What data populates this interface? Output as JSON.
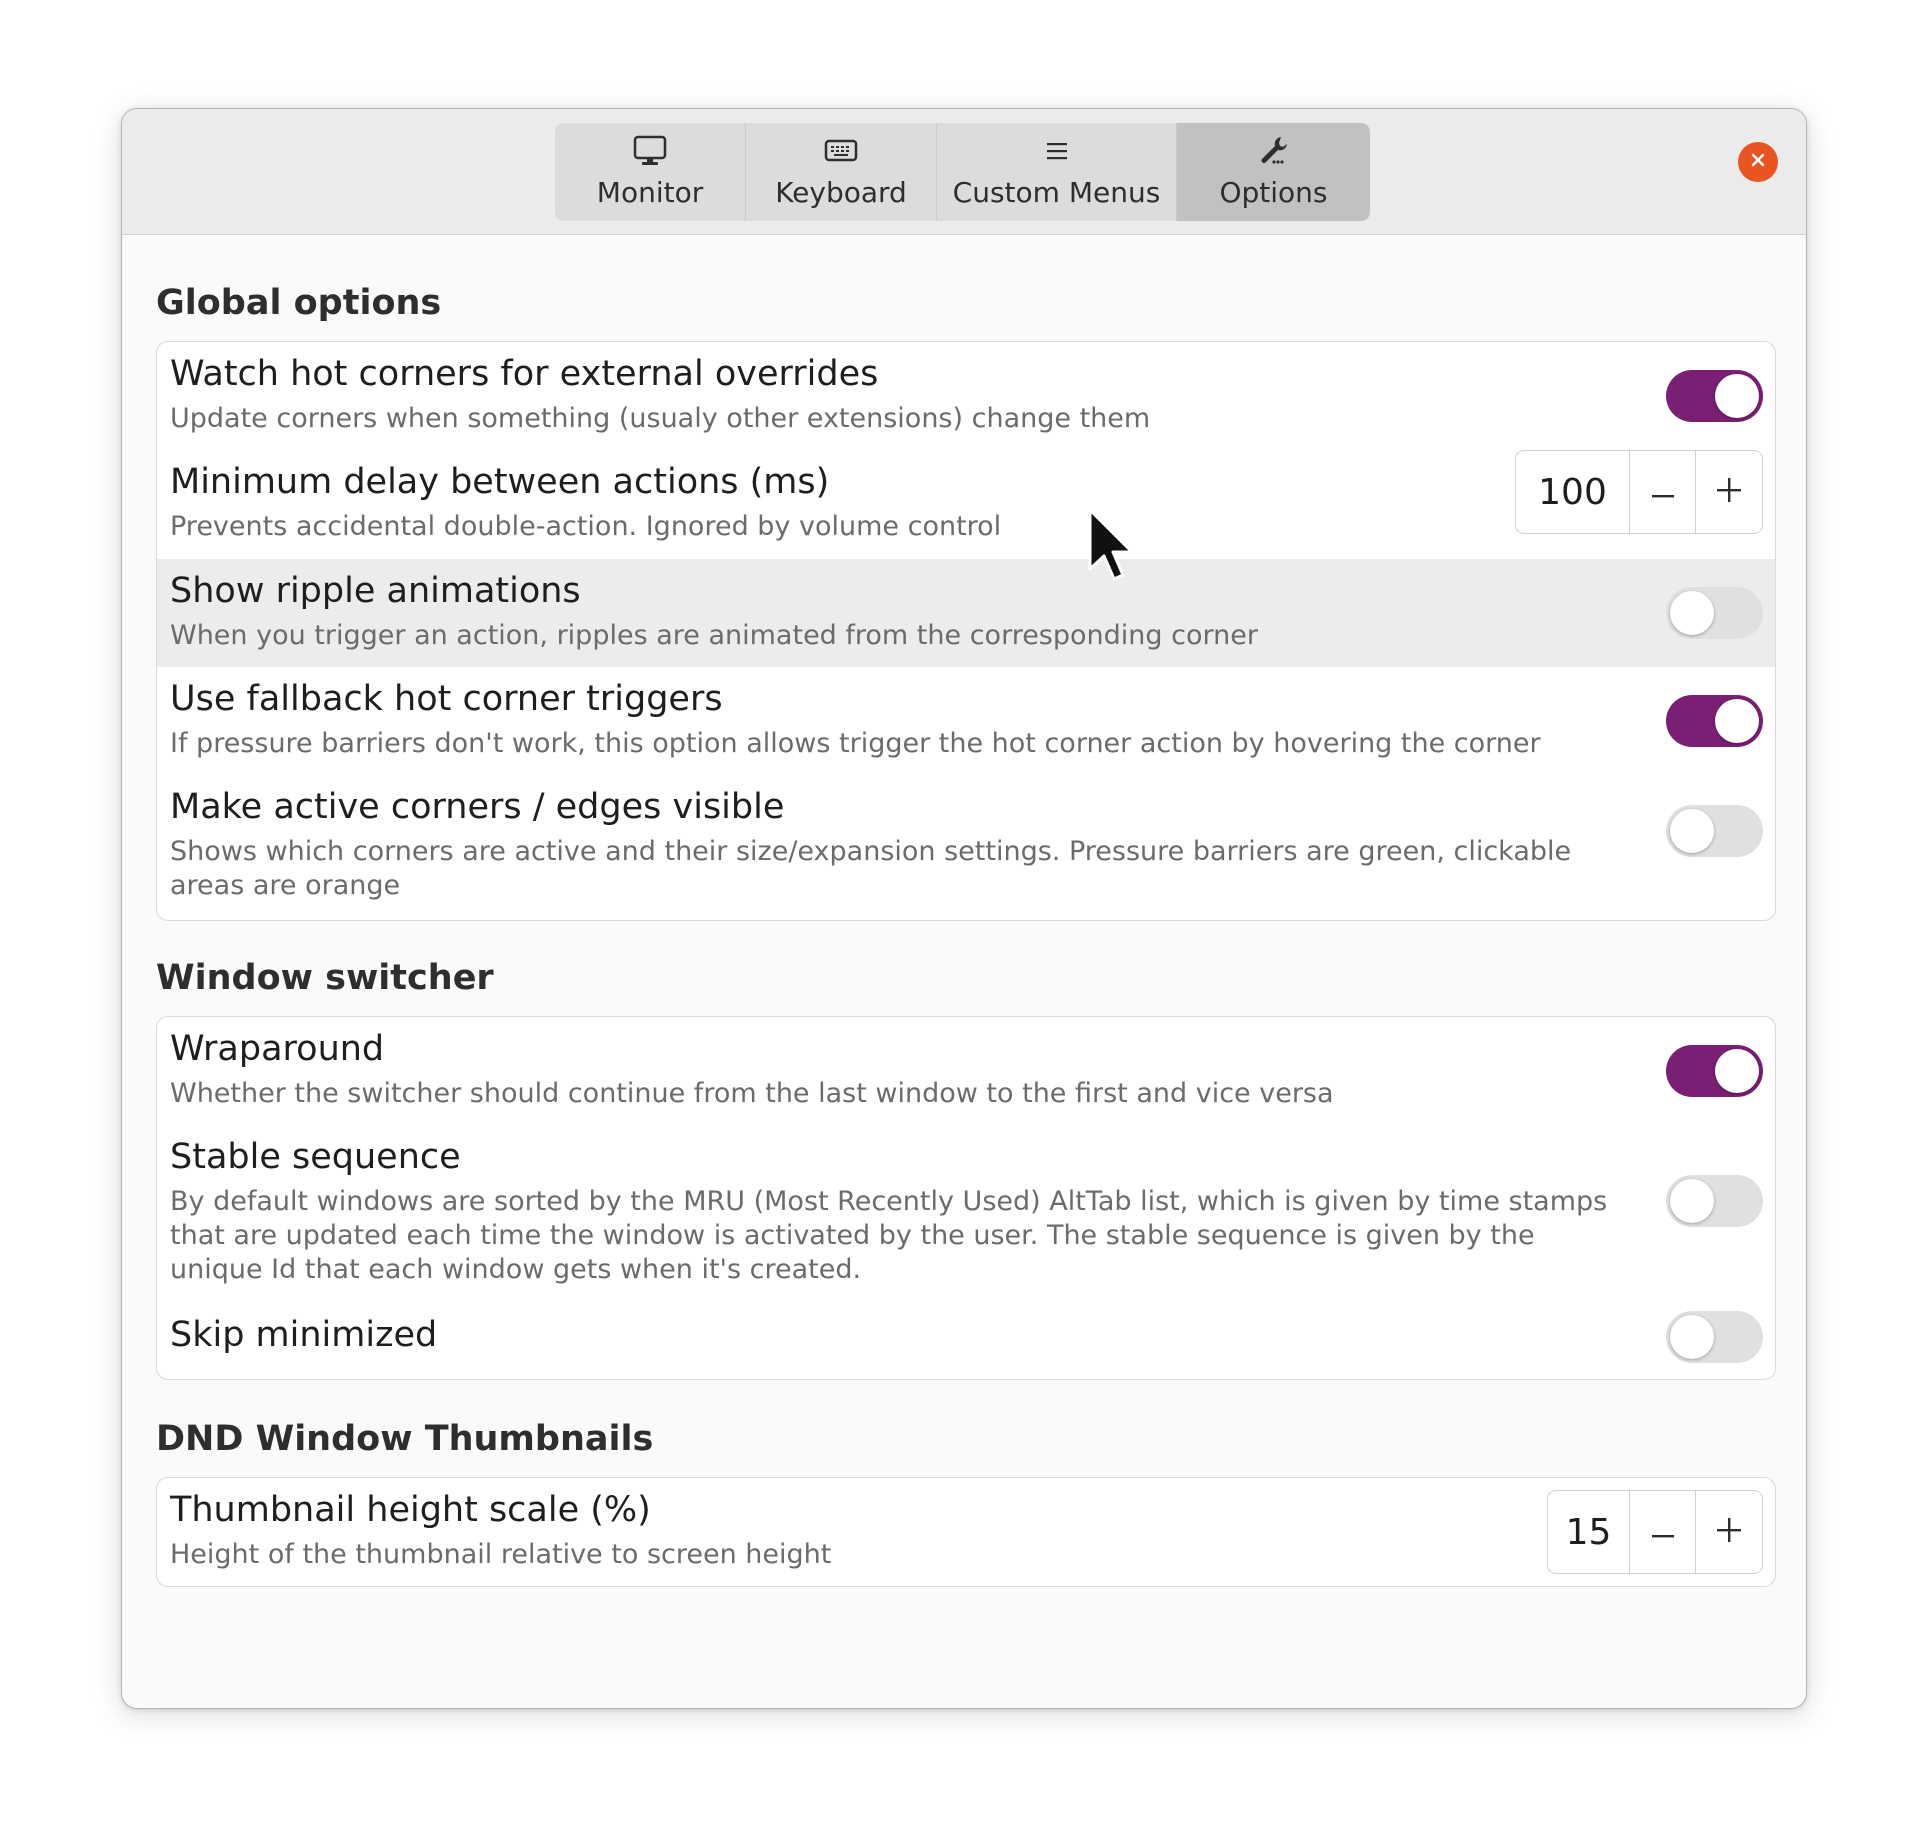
{
  "window": {
    "tabs": [
      {
        "label": "Monitor",
        "icon": "monitor-icon",
        "active": false
      },
      {
        "label": "Keyboard",
        "icon": "keyboard-icon",
        "active": false
      },
      {
        "label": "Custom Menus",
        "icon": "menu-icon",
        "active": false
      },
      {
        "label": "Options",
        "icon": "wrench-icon",
        "active": true
      }
    ],
    "close_color": "#e95420",
    "accent_color": "#7a1f73"
  },
  "global": {
    "title": "Global options",
    "rows": [
      {
        "title": "Watch hot corners for external overrides",
        "subtitle": "Update corners when something (usualy other extensions) change them",
        "toggle": true
      },
      {
        "title": "Minimum delay between actions (ms)",
        "subtitle": "Prevents accidental double-action. Ignored by volume control",
        "value": "100"
      },
      {
        "title": "Show ripple animations",
        "subtitle": "When you trigger an action, ripples are animated from the corresponding corner",
        "toggle": false
      },
      {
        "title": "Use fallback hot corner triggers",
        "subtitle": "If pressure barriers don't work, this option allows trigger the hot corner action by hovering the corner",
        "toggle": true
      },
      {
        "title": "Make active corners / edges visible",
        "subtitle": "Shows which corners are active and their size/expansion settings. Pressure barriers are green, clickable areas are orange",
        "toggle": false
      }
    ]
  },
  "switcher": {
    "title": "Window switcher",
    "rows": [
      {
        "title": "Wraparound",
        "subtitle": "Whether the switcher should continue from the last window to the first and vice versa",
        "toggle": true
      },
      {
        "title": "Stable sequence",
        "subtitle": "By default windows are sorted by the MRU (Most Recently Used) AltTab list, which is given by time stamps that are updated each time the window is activated by the user. The stable sequence is given by the unique Id that each window gets when it's created.",
        "toggle": false
      },
      {
        "title": "Skip minimized",
        "toggle": false
      }
    ]
  },
  "dnd": {
    "title": "DND Window Thumbnails",
    "rows": [
      {
        "title": "Thumbnail height scale (%)",
        "subtitle": "Height of the thumbnail relative to screen height",
        "value": "15"
      }
    ]
  }
}
